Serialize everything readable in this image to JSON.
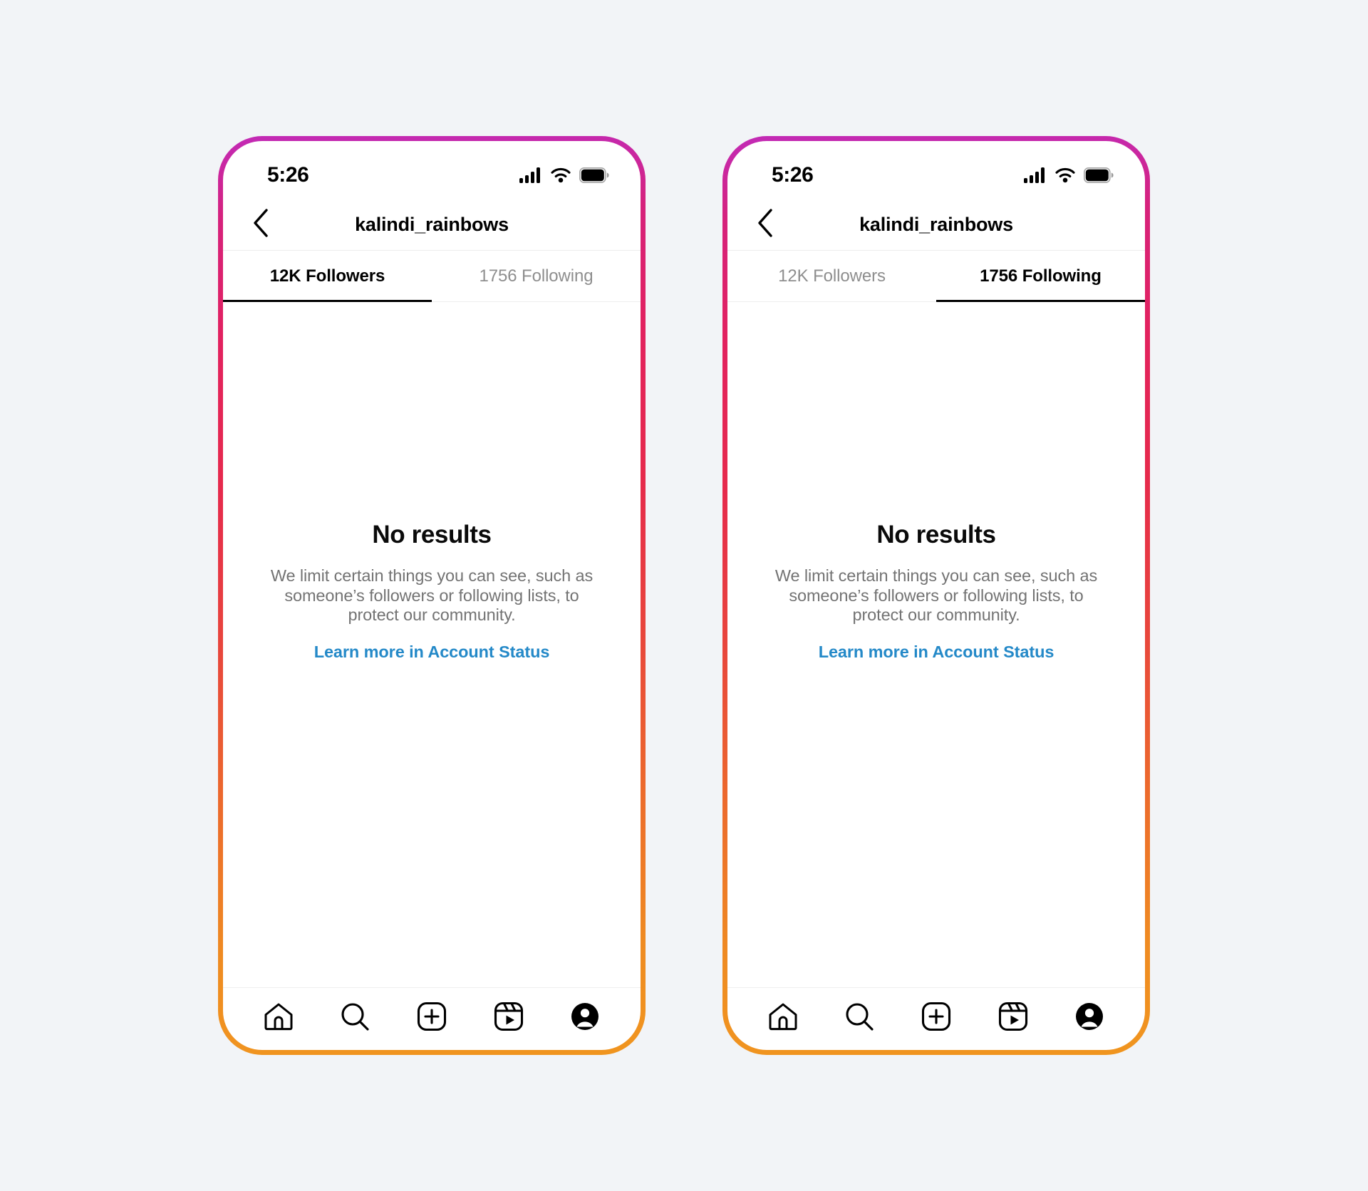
{
  "page": {
    "background_color": "#f2f4f7",
    "frame_gradient": [
      "#c22ab6",
      "#d6227c",
      "#e2225f",
      "#e8463c",
      "#ec6b2c",
      "#f0951f"
    ]
  },
  "status_bar": {
    "time": "5:26",
    "icons": [
      "cellular-signal-icon",
      "wifi-icon",
      "battery-icon"
    ]
  },
  "nav": {
    "back_icon": "chevron-left-icon",
    "title": "kalindi_rainbows"
  },
  "tabs": [
    {
      "label": "12K Followers"
    },
    {
      "label": "1756 Following"
    }
  ],
  "empty_state": {
    "title": "No results",
    "description": "We limit certain things you can see, such as someone’s followers or following lists, to protect our community.",
    "link_label": "Learn more in Account Status",
    "link_color": "#2489c8"
  },
  "tab_bar": {
    "items": [
      {
        "name": "home-icon",
        "label": "Home"
      },
      {
        "name": "search-icon",
        "label": "Search"
      },
      {
        "name": "create-icon",
        "label": "Create"
      },
      {
        "name": "reels-icon",
        "label": "Reels"
      },
      {
        "name": "profile-icon",
        "label": "Profile"
      }
    ]
  },
  "phones": [
    {
      "id": "left",
      "active_tab_index": 0
    },
    {
      "id": "right",
      "active_tab_index": 1
    }
  ]
}
